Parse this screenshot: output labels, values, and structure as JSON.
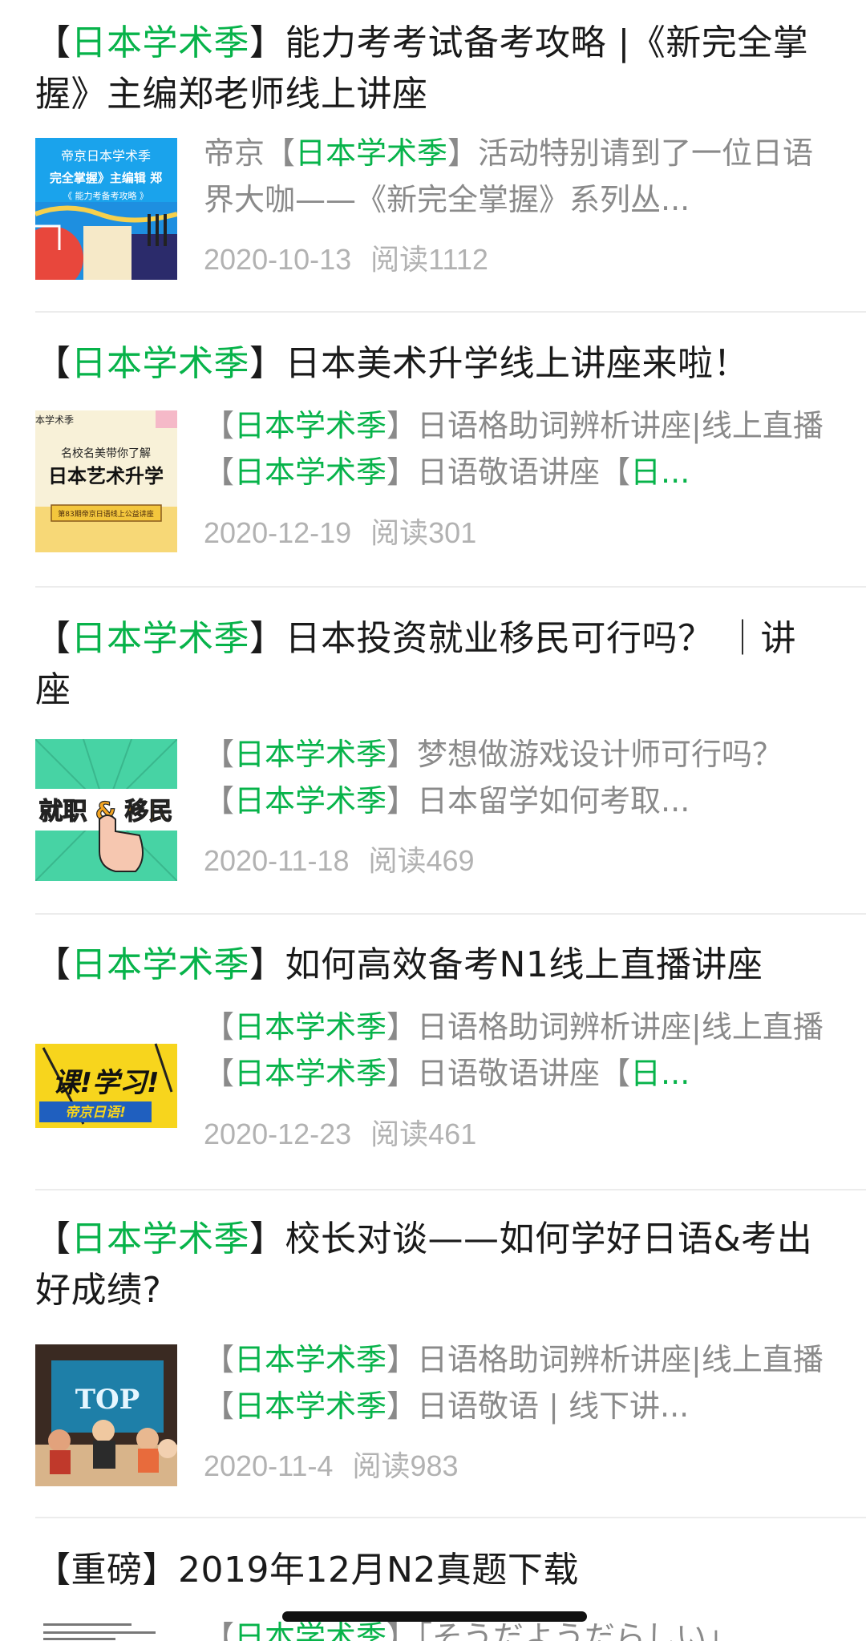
{
  "articles": [
    {
      "title": [
        "【",
        "日本学术季",
        "】能力考考试备考攻略 |《新完全掌握》主编郑老师线上讲座"
      ],
      "digest": [
        "帝京【",
        "日本学术季",
        "】活动特别请到了一位日语界大咖——《新完全掌握》系列丛..."
      ],
      "date": "2020-10-13",
      "reads": "阅读1112",
      "thumb": {
        "line1": "帝京日本学术季",
        "line2": "完全掌握》主编辑 郑",
        "line3": "《 能力考备考攻略 》"
      }
    },
    {
      "title": [
        "【",
        "日本学术季",
        "】日本美术升学线上讲座来啦！"
      ],
      "digest_parts": [
        "【",
        "日本学术季",
        "】日语格助词辨析讲座|线上直播【",
        "日本学术季",
        "】日语敬语讲座【",
        "日...",
        ""
      ],
      "date": "2020-12-19",
      "reads": "阅读301",
      "thumb": {
        "line1": "本学术季",
        "line2": "名校名美带你了解",
        "line3": "日本艺术升学",
        "line4": "第83期帝京日语线上公益讲座"
      }
    },
    {
      "title": [
        "【",
        "日本学术季",
        "】日本投资就业移民可行吗？ ｜讲座"
      ],
      "digest_parts": [
        "【",
        "日本学术季",
        "】梦想做游戏设计师可行吗？【",
        "日本学术季",
        "】日本留学如何考取..."
      ],
      "date": "2020-11-18",
      "reads": "阅读469",
      "thumb": {
        "line1": "就职 & 移民"
      }
    },
    {
      "title": [
        "【",
        "日本学术季",
        "】如何高效备考N1线上直播讲座"
      ],
      "digest_parts": [
        "【",
        "日本学术季",
        "】日语格助词辨析讲座|线上直播【",
        "日本学术季",
        "】日语敬语讲座【",
        "日..."
      ],
      "date": "2020-12-23",
      "reads": "阅读461",
      "thumb": {
        "line1": "课!学习!",
        "line2": "帝京日语!"
      }
    },
    {
      "title": [
        "【",
        "日本学术季",
        "】校长对谈——如何学好日语&考出好成绩?"
      ],
      "digest_parts": [
        "【",
        "日本学术季",
        "】日语格助词辨析讲座|线上直播【",
        "日本学术季",
        "】日语敬语 | 线下讲..."
      ],
      "date": "2020-11-4",
      "reads": "阅读983",
      "thumb": {
        "line1": "TOP"
      }
    },
    {
      "title_plain": "【重磅】2019年12月N2真题下载",
      "digest_parts": [
        "【",
        "日本学术季",
        "】「そうだようだらしい」"
      ]
    }
  ],
  "colors": {
    "highlight": "#07b34a",
    "meta": "#b2b2b2",
    "digest": "#8a8a8a",
    "title": "#1a1a1a"
  }
}
